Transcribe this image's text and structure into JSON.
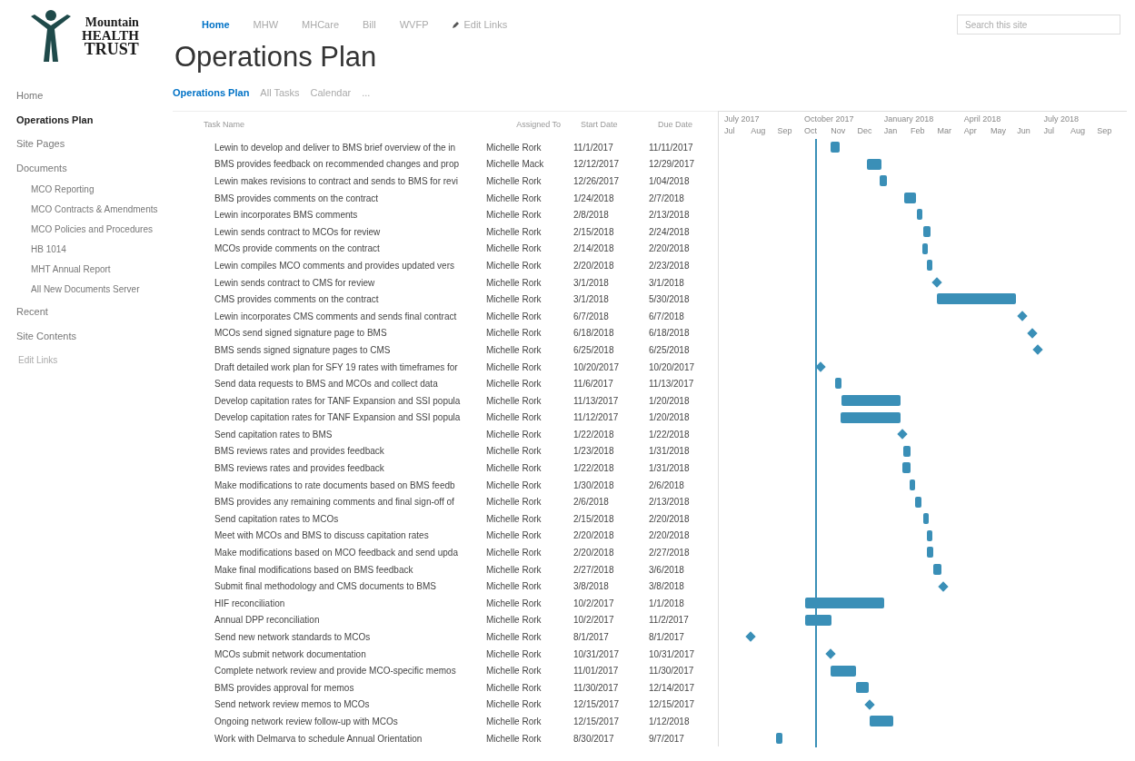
{
  "logo": {
    "line_1": "Mountain",
    "line_2": "HEALTH",
    "line_3": "TRUST"
  },
  "top_nav": [
    {
      "label": "Home",
      "selected": true
    },
    {
      "label": "MHW",
      "selected": false
    },
    {
      "label": "MHCare",
      "selected": false
    },
    {
      "label": "Bill",
      "selected": false
    },
    {
      "label": "WVFP",
      "selected": false
    }
  ],
  "edit_links_top": "Edit Links",
  "search": {
    "placeholder": "Search this site"
  },
  "page_title": "Operations Plan",
  "sidebar": {
    "items": [
      {
        "label": "Home",
        "selected": false
      },
      {
        "label": "Operations Plan",
        "selected": true
      },
      {
        "label": "Site Pages",
        "selected": false
      },
      {
        "label": "Documents",
        "selected": false,
        "children": [
          {
            "label": "MCO Reporting",
            "selected": false
          },
          {
            "label": "MCO Contracts & Amendments",
            "selected": false
          },
          {
            "label": "MCO Policies and Procedures",
            "selected": false
          },
          {
            "label": "HB 1014",
            "selected": false
          },
          {
            "label": "MHT Annual Report",
            "selected": false
          },
          {
            "label": "All New Documents Server",
            "selected": false
          }
        ]
      },
      {
        "label": "Recent",
        "selected": false
      },
      {
        "label": "Site Contents",
        "selected": false
      }
    ],
    "edit_links": "Edit Links"
  },
  "view_tabs": [
    {
      "label": "Operations Plan",
      "selected": true
    },
    {
      "label": "All Tasks",
      "selected": false
    },
    {
      "label": "Calendar",
      "selected": false
    },
    {
      "label": "...",
      "selected": false
    }
  ],
  "table": {
    "columns": [
      "Task Name",
      "Assigned To",
      "Start Date",
      "Due Date"
    ],
    "rows": [
      {
        "task": "Lewin to develop and deliver to BMS brief overview of the in",
        "assigned": "Michelle Rork",
        "start": "11/1/2017",
        "due": "11/11/2017",
        "kind": "bar"
      },
      {
        "task": "BMS provides feedback on recommended changes and prop",
        "assigned": "Michelle Mack",
        "start": "12/12/2017",
        "due": "12/29/2017",
        "kind": "bar"
      },
      {
        "task": "Lewin makes revisions to contract and sends to BMS for revi",
        "assigned": "Michelle Rork",
        "start": "12/26/2017",
        "due": "1/04/2018",
        "kind": "bar"
      },
      {
        "task": "BMS provides comments on the contract",
        "assigned": "Michelle Rork",
        "start": "1/24/2018",
        "due": "2/7/2018",
        "kind": "bar"
      },
      {
        "task": "Lewin incorporates BMS comments",
        "assigned": "Michelle Rork",
        "start": "2/8/2018",
        "due": "2/13/2018",
        "kind": "bar"
      },
      {
        "task": "Lewin sends contract to MCOs for review",
        "assigned": "Michelle Rork",
        "start": "2/15/2018",
        "due": "2/24/2018",
        "kind": "bar"
      },
      {
        "task": "MCOs provide comments on the contract",
        "assigned": "Michelle Rork",
        "start": "2/14/2018",
        "due": "2/20/2018",
        "kind": "bar"
      },
      {
        "task": "Lewin compiles MCO comments and provides updated vers",
        "assigned": "Michelle Rork",
        "start": "2/20/2018",
        "due": "2/23/2018",
        "kind": "bar"
      },
      {
        "task": "Lewin sends contract to CMS for review",
        "assigned": "Michelle Rork",
        "start": "3/1/2018",
        "due": "3/1/2018",
        "kind": "milestone"
      },
      {
        "task": "CMS provides comments on the contract",
        "assigned": "Michelle Rork",
        "start": "3/1/2018",
        "due": "5/30/2018",
        "kind": "bar"
      },
      {
        "task": "Lewin incorporates CMS comments and sends final contract",
        "assigned": "Michelle Rork",
        "start": "6/7/2018",
        "due": "6/7/2018",
        "kind": "milestone"
      },
      {
        "task": "MCOs send signed signature page to BMS",
        "assigned": "Michelle Rork",
        "start": "6/18/2018",
        "due": "6/18/2018",
        "kind": "milestone"
      },
      {
        "task": "BMS sends signed signature pages to CMS",
        "assigned": "Michelle Rork",
        "start": "6/25/2018",
        "due": "6/25/2018",
        "kind": "milestone"
      },
      {
        "task": "Draft detailed work plan for SFY 19 rates with timeframes for",
        "assigned": "Michelle Rork",
        "start": "10/20/2017",
        "due": "10/20/2017",
        "kind": "milestone"
      },
      {
        "task": "Send data requests to BMS and MCOs and collect data",
        "assigned": "Michelle Rork",
        "start": "11/6/2017",
        "due": "11/13/2017",
        "kind": "bar"
      },
      {
        "task": "Develop capitation rates for TANF Expansion and SSI popula",
        "assigned": "Michelle Rork",
        "start": "11/13/2017",
        "due": "1/20/2018",
        "kind": "bar"
      },
      {
        "task": "Develop capitation rates for TANF Expansion and SSI popula",
        "assigned": "Michelle Rork",
        "start": "11/12/2017",
        "due": "1/20/2018",
        "kind": "bar"
      },
      {
        "task": "Send capitation rates to BMS",
        "assigned": "Michelle Rork",
        "start": "1/22/2018",
        "due": "1/22/2018",
        "kind": "milestone"
      },
      {
        "task": "BMS reviews rates and provides feedback",
        "assigned": "Michelle Rork",
        "start": "1/23/2018",
        "due": "1/31/2018",
        "kind": "bar"
      },
      {
        "task": "BMS reviews rates and provides feedback",
        "assigned": "Michelle Rork",
        "start": "1/22/2018",
        "due": "1/31/2018",
        "kind": "bar"
      },
      {
        "task": "Make modifications to rate documents based on BMS feedb",
        "assigned": "Michelle Rork",
        "start": "1/30/2018",
        "due": "2/6/2018",
        "kind": "bar"
      },
      {
        "task": "BMS provides any remaining comments and final sign-off of",
        "assigned": "Michelle Rork",
        "start": "2/6/2018",
        "due": "2/13/2018",
        "kind": "bar"
      },
      {
        "task": "Send capitation rates to MCOs",
        "assigned": "Michelle Rork",
        "start": "2/15/2018",
        "due": "2/20/2018",
        "kind": "bar"
      },
      {
        "task": "Meet with MCOs and BMS to discuss capitation rates",
        "assigned": "Michelle Rork",
        "start": "2/20/2018",
        "due": "2/20/2018",
        "kind": "bar"
      },
      {
        "task": "Make modifications based on MCO feedback and send upda",
        "assigned": "Michelle Rork",
        "start": "2/20/2018",
        "due": "2/27/2018",
        "kind": "bar"
      },
      {
        "task": "Make final modifications based on BMS feedback",
        "assigned": "Michelle Rork",
        "start": "2/27/2018",
        "due": "3/6/2018",
        "kind": "bar"
      },
      {
        "task": "Submit final methodology and CMS documents to BMS",
        "assigned": "Michelle Rork",
        "start": "3/8/2018",
        "due": "3/8/2018",
        "kind": "milestone"
      },
      {
        "task": "HIF reconciliation",
        "assigned": "Michelle Rork",
        "start": "10/2/2017",
        "due": "1/1/2018",
        "kind": "bar"
      },
      {
        "task": "Annual DPP reconciliation",
        "assigned": "Michelle Rork",
        "start": "10/2/2017",
        "due": "11/2/2017",
        "kind": "bar"
      },
      {
        "task": "Send new network standards to MCOs",
        "assigned": "Michelle Rork",
        "start": "8/1/2017",
        "due": "8/1/2017",
        "kind": "milestone"
      },
      {
        "task": "MCOs submit network documentation",
        "assigned": "Michelle Rork",
        "start": "10/31/2017",
        "due": "10/31/2017",
        "kind": "milestone"
      },
      {
        "task": "Complete network review and provide MCO-specific memos",
        "assigned": "Michelle Rork",
        "start": "11/01/2017",
        "due": "11/30/2017",
        "kind": "bar"
      },
      {
        "task": "BMS provides approval for memos",
        "assigned": "Michelle Rork",
        "start": "11/30/2017",
        "due": "12/14/2017",
        "kind": "bar"
      },
      {
        "task": "Send network review memos to MCOs",
        "assigned": "Michelle Rork",
        "start": "12/15/2017",
        "due": "12/15/2017",
        "kind": "milestone"
      },
      {
        "task": "Ongoing network review follow-up with MCOs",
        "assigned": "Michelle Rork",
        "start": "12/15/2017",
        "due": "1/12/2018",
        "kind": "bar"
      },
      {
        "task": "Work with Delmarva to schedule Annual Orientation",
        "assigned": "Michelle Rork",
        "start": "8/30/2017",
        "due": "9/7/2017",
        "kind": "bar"
      }
    ]
  },
  "timeline": {
    "quarters": [
      "July 2017",
      "October 2017",
      "January 2018",
      "April 2018",
      "July 2018"
    ],
    "months": [
      "Jul",
      "Aug",
      "Sep",
      "Oct",
      "Nov",
      "Dec",
      "Jan",
      "Feb",
      "Mar",
      "Apr",
      "May",
      "Jun",
      "Jul",
      "Aug",
      "Sep"
    ]
  }
}
